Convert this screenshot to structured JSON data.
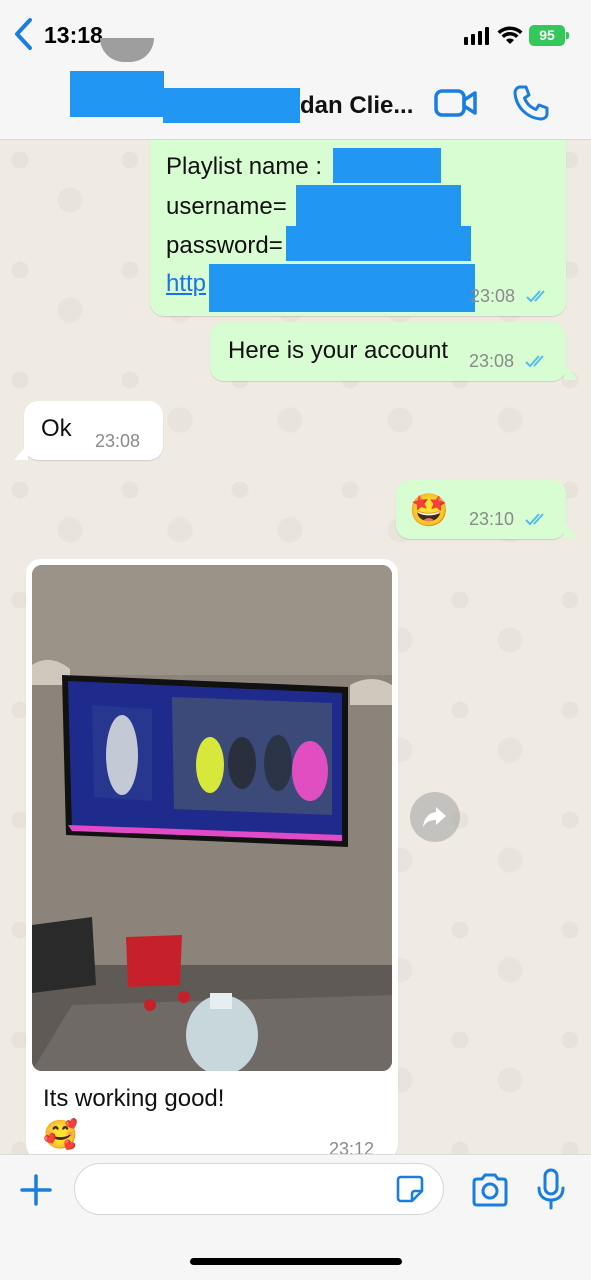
{
  "status_bar": {
    "time": "13:18",
    "battery": "95",
    "icons": [
      "signal-icon",
      "wifi-icon",
      "battery-icon"
    ]
  },
  "header": {
    "contact_name": "dan Clie...",
    "icons": [
      "back-icon",
      "video-call-icon",
      "phone-call-icon"
    ]
  },
  "messages": [
    {
      "direction": "outgoing",
      "lines": [
        "Playlist name :",
        "username=",
        "password=",
        "http"
      ],
      "time": "23:08",
      "status": "read"
    },
    {
      "direction": "outgoing",
      "text": "Here is your account",
      "time": "23:08",
      "status": "read"
    },
    {
      "direction": "incoming",
      "text": "Ok",
      "time": "23:08"
    },
    {
      "direction": "outgoing",
      "emoji": "🤩",
      "time": "23:10",
      "status": "read"
    },
    {
      "direction": "incoming",
      "type": "photo",
      "caption": "Its working good!",
      "emoji": "🥰",
      "time": "23:12"
    }
  ],
  "composer": {
    "placeholder": "",
    "icons": [
      "plus-icon",
      "sticker-icon",
      "camera-icon",
      "microphone-icon"
    ]
  },
  "colors": {
    "outgoing_bubble": "#d9fdd3",
    "incoming_bubble": "#ffffff",
    "accent": "#1a7ee0",
    "read_ticks": "#53bdeb",
    "redaction": "#2196f3"
  }
}
